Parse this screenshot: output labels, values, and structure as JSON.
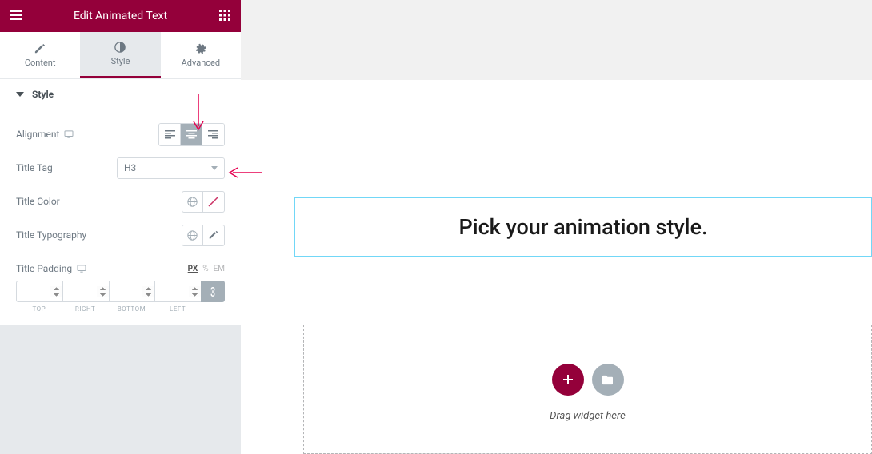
{
  "header": {
    "title": "Edit Animated Text"
  },
  "tabs": {
    "content": "Content",
    "style": "Style",
    "advanced": "Advanced"
  },
  "section": {
    "title": "Style"
  },
  "controls": {
    "alignment": {
      "label": "Alignment"
    },
    "title_tag": {
      "label": "Title Tag",
      "value": "H3"
    },
    "title_color": {
      "label": "Title Color"
    },
    "title_typography": {
      "label": "Title Typography"
    },
    "title_padding": {
      "label": "Title Padding",
      "units": {
        "px": "PX",
        "pct": "%",
        "em": "EM"
      },
      "dims": {
        "top": "TOP",
        "right": "RIGHT",
        "bottom": "BOTTOM",
        "left": "LEFT"
      }
    }
  },
  "canvas": {
    "widget_text": "Pick your animation style.",
    "drop_label": "Drag widget here"
  }
}
